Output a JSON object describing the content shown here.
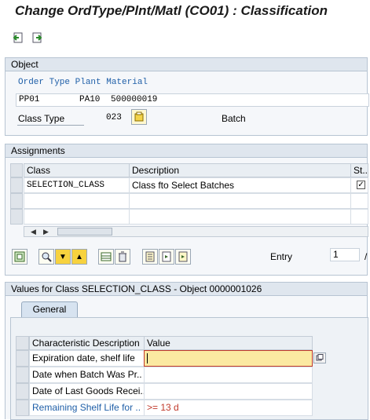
{
  "window": {
    "title": "Change OrdType/Plnt/Matl (CO01) : Classification"
  },
  "toolbar": {
    "back_icon": "back-icon",
    "forward_icon": "forward-icon"
  },
  "object": {
    "section_title": "Object",
    "key_header": "Order Type Plant Material",
    "key_values": {
      "order_type": "PP01",
      "plant": "PA10",
      "material": "500000019"
    },
    "class_type_label": "Class Type",
    "class_type_value": "023",
    "class_type_desc": "Batch"
  },
  "assignments": {
    "section_title": "Assignments",
    "columns": [
      "Class",
      "Description",
      "St.."
    ],
    "rows": [
      {
        "class": "SELECTION_CLASS",
        "description": "Class fto Select Batches",
        "status_checked": true
      },
      {
        "class": "",
        "description": "",
        "status_checked": false
      },
      {
        "class": "",
        "description": "",
        "status_checked": false
      }
    ],
    "entry_label": "Entry",
    "entry_value": "1",
    "entry_total": "/"
  },
  "values": {
    "section_title": "Values for Class SELECTION_CLASS - Object 0000001026",
    "tab_label": "General",
    "columns": [
      "Characteristic Description",
      "Value"
    ],
    "rows": [
      {
        "desc": "Expiration date, shelf life",
        "value": ""
      },
      {
        "desc": "Date when Batch Was Pr..",
        "value": ""
      },
      {
        "desc": "Date of Last Goods Recei..",
        "value": ""
      },
      {
        "desc": "Remaining Shelf Life for ..",
        "value": ">= 13 d"
      }
    ]
  },
  "colors": {
    "link_blue": "#1f5fa8",
    "value_red": "#c0392b",
    "highlight": "#fbe9a1",
    "panel_header": "#dfe6ee"
  }
}
